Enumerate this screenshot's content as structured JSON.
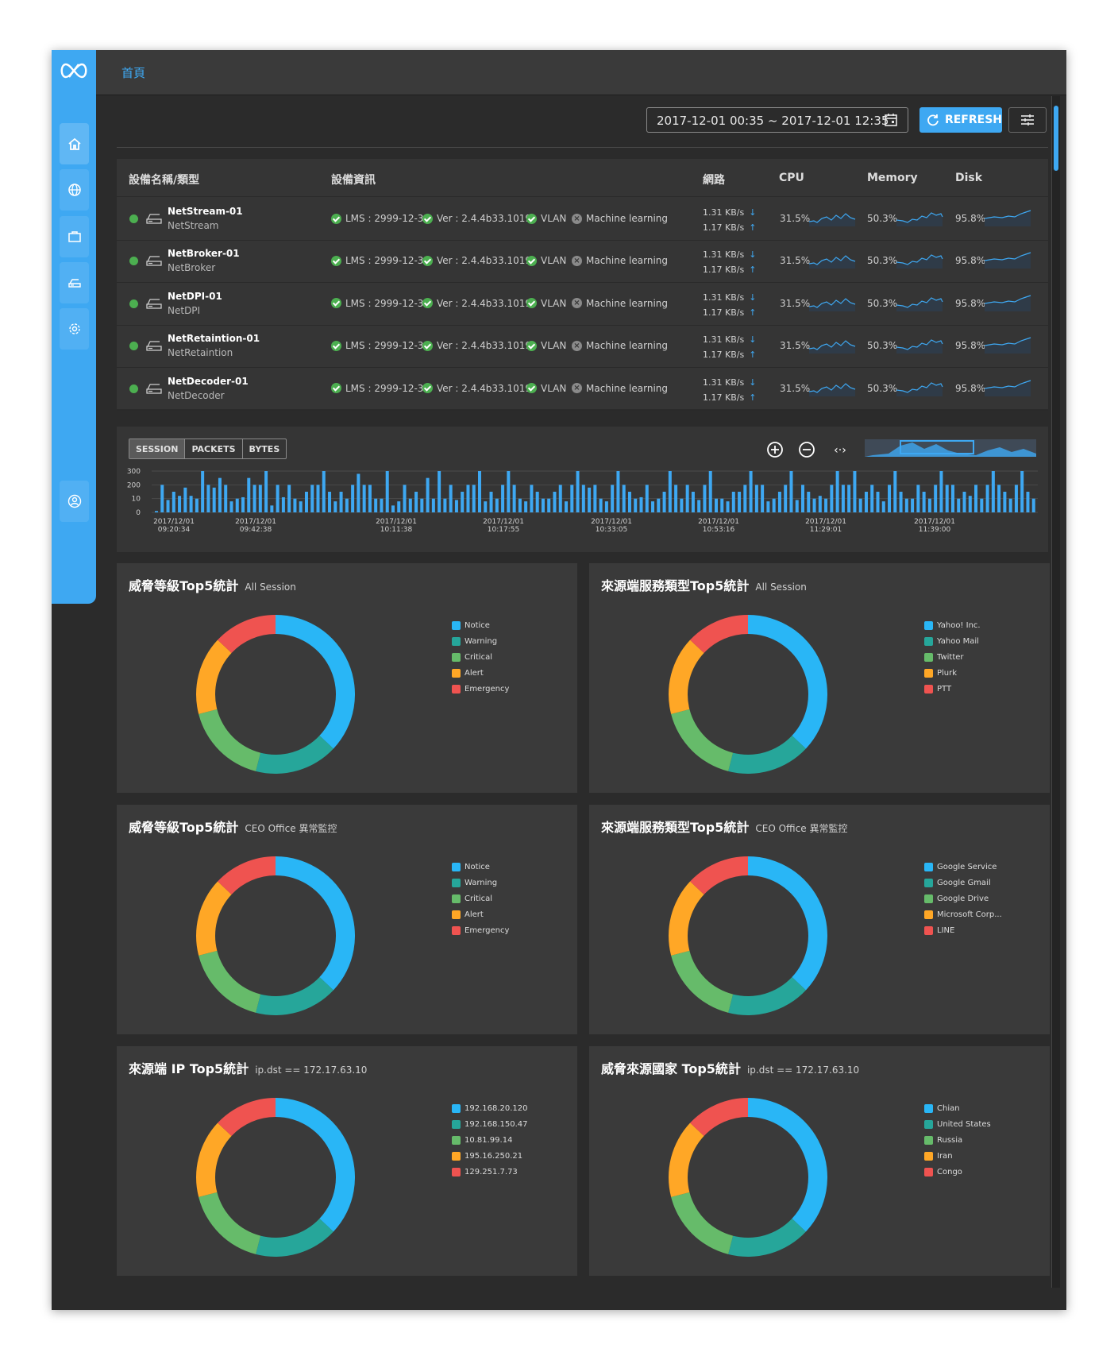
{
  "breadcrumb": "首頁",
  "toolbar": {
    "date_range": "2017-12-01 00:35 ~ 2017-12-01 12:35",
    "refresh_label": "REFRESH"
  },
  "sidebar": {
    "items": [
      "home-icon",
      "globe-icon",
      "briefcase-icon",
      "device-icon",
      "settings-icon",
      "user-icon"
    ]
  },
  "devices": {
    "headers": {
      "name": "設備名稱/類型",
      "info": "設備資訊",
      "network": "網路",
      "cpu": "CPU",
      "memory": "Memory",
      "disk": "Disk"
    },
    "rows": [
      {
        "name": "NetStream-01",
        "type": "NetStream",
        "lms": "LMS : 2999-12-31",
        "ver": "Ver : 2.4.4b33.1019",
        "vlan": "VLAN",
        "ml": "Machine learning",
        "down": "1.31 KB/s",
        "up": "1.17 KB/s",
        "cpu": "31.5%",
        "memory": "50.3%",
        "disk": "95.8%"
      },
      {
        "name": "NetBroker-01",
        "type": "NetBroker",
        "lms": "LMS : 2999-12-31",
        "ver": "Ver : 2.4.4b33.1019",
        "vlan": "VLAN",
        "ml": "Machine learning",
        "down": "1.31 KB/s",
        "up": "1.17 KB/s",
        "cpu": "31.5%",
        "memory": "50.3%",
        "disk": "95.8%"
      },
      {
        "name": "NetDPI-01",
        "type": "NetDPI",
        "lms": "LMS : 2999-12-31",
        "ver": "Ver : 2.4.4b33.1019",
        "vlan": "VLAN",
        "ml": "Machine learning",
        "down": "1.31 KB/s",
        "up": "1.17 KB/s",
        "cpu": "31.5%",
        "memory": "50.3%",
        "disk": "95.8%"
      },
      {
        "name": "NetRetaintion-01",
        "type": "NetRetaintion",
        "lms": "LMS : 2999-12-31",
        "ver": "Ver : 2.4.4b33.1019",
        "vlan": "VLAN",
        "ml": "Machine learning",
        "down": "1.31 KB/s",
        "up": "1.17 KB/s",
        "cpu": "31.5%",
        "memory": "50.3%",
        "disk": "95.8%"
      },
      {
        "name": "NetDecoder-01",
        "type": "NetDecoder",
        "lms": "LMS : 2999-12-31",
        "ver": "Ver : 2.4.4b33.1019",
        "vlan": "VLAN",
        "ml": "Machine learning",
        "down": "1.31 KB/s",
        "up": "1.17 KB/s",
        "cpu": "31.5%",
        "memory": "50.3%",
        "disk": "95.8%"
      }
    ]
  },
  "session": {
    "tabs": [
      "SESSION",
      "PACKETS",
      "BYTES"
    ],
    "active_tab": "SESSION"
  },
  "chart_data": [
    {
      "type": "bar",
      "y_tick_labels": [
        "300",
        "200",
        "10",
        "0"
      ],
      "x_tick_labels": [
        "2017/12/01 09:20:34",
        "2017/12/01 09:42:38",
        "2017/12/01 10:11:38",
        "2017/12/01 10:17:55",
        "2017/12/01 10:33:05",
        "2017/12/01 10:53:16",
        "2017/12/01 11:29:01",
        "2017/12/01 11:39:00"
      ],
      "values": [
        10,
        200,
        90,
        150,
        120,
        180,
        120,
        100,
        300,
        200,
        180,
        250,
        200,
        80,
        100,
        110,
        250,
        200,
        200,
        300,
        50,
        200,
        110,
        200,
        100,
        80,
        150,
        200,
        200,
        300,
        150,
        80,
        150,
        100,
        200,
        280,
        200,
        200,
        100,
        100,
        300,
        50,
        80,
        200,
        100,
        150,
        100,
        250,
        100,
        300,
        100,
        200,
        90,
        150,
        200,
        200,
        300,
        80,
        150,
        100,
        200,
        300,
        200,
        100,
        80,
        200,
        150,
        100,
        100,
        150,
        200,
        80,
        200,
        300,
        200,
        180,
        200,
        100,
        80,
        200,
        300,
        200,
        150,
        100,
        110,
        200,
        80,
        100,
        150,
        300,
        200,
        100,
        200,
        150,
        90,
        200,
        300,
        100,
        100,
        80,
        150,
        150,
        200,
        300,
        200,
        200,
        80,
        100,
        150,
        200,
        300,
        90,
        200,
        150,
        100,
        120,
        100,
        200,
        300,
        200,
        200,
        300,
        100,
        150,
        200,
        150,
        80,
        200,
        300,
        150,
        100,
        100,
        200,
        150,
        100,
        200,
        300,
        200,
        200,
        100,
        150,
        120,
        200,
        100,
        200,
        300,
        200,
        150,
        100,
        200,
        300,
        150,
        100
      ]
    },
    {
      "type": "pie",
      "title": "威脅等級Top5統計",
      "subtitle": "All Session",
      "categories": [
        "Notice",
        "Warning",
        "Critical",
        "Alert",
        "Emergency"
      ],
      "values": [
        37,
        17,
        17,
        16,
        13
      ]
    },
    {
      "type": "pie",
      "title": "來源端服務類型Top5統計",
      "subtitle": "All Session",
      "categories": [
        "Yahoo! Inc.",
        "Yahoo Mail",
        "Twitter",
        "Plurk",
        "PTT"
      ],
      "values": [
        37,
        17,
        17,
        16,
        13
      ]
    },
    {
      "type": "pie",
      "title": "威脅等級Top5統計",
      "subtitle": "CEO Office 異常監控",
      "categories": [
        "Notice",
        "Warning",
        "Critical",
        "Alert",
        "Emergency"
      ],
      "values": [
        37,
        17,
        17,
        16,
        13
      ]
    },
    {
      "type": "pie",
      "title": "來源端服務類型Top5統計",
      "subtitle": "CEO Office 異常監控",
      "categories": [
        "Google Service",
        "Google Gmail",
        "Google Drive",
        "Microsoft Corp...",
        "LINE"
      ],
      "values": [
        37,
        17,
        17,
        16,
        13
      ]
    },
    {
      "type": "pie",
      "title": "來源端 IP Top5統計",
      "subtitle": "ip.dst == 172.17.63.10",
      "categories": [
        "192.168.20.120",
        "192.168.150.47",
        "10.81.99.14",
        "195.16.250.21",
        "129.251.7.73"
      ],
      "values": [
        37,
        17,
        17,
        16,
        13
      ]
    },
    {
      "type": "pie",
      "title": "威脅來源國家 Top5統計",
      "subtitle": "ip.dst == 172.17.63.10",
      "categories": [
        "Chian",
        "United States",
        "Russia",
        "Iran",
        "Congo"
      ],
      "values": [
        37,
        17,
        17,
        16,
        13
      ]
    }
  ],
  "colors": {
    "accent": "#3ea8f2",
    "series": [
      "#29b6f6",
      "#26a69a",
      "#66bb6a",
      "#ffa726",
      "#ef5350"
    ],
    "status_ok": "#4caf50"
  }
}
